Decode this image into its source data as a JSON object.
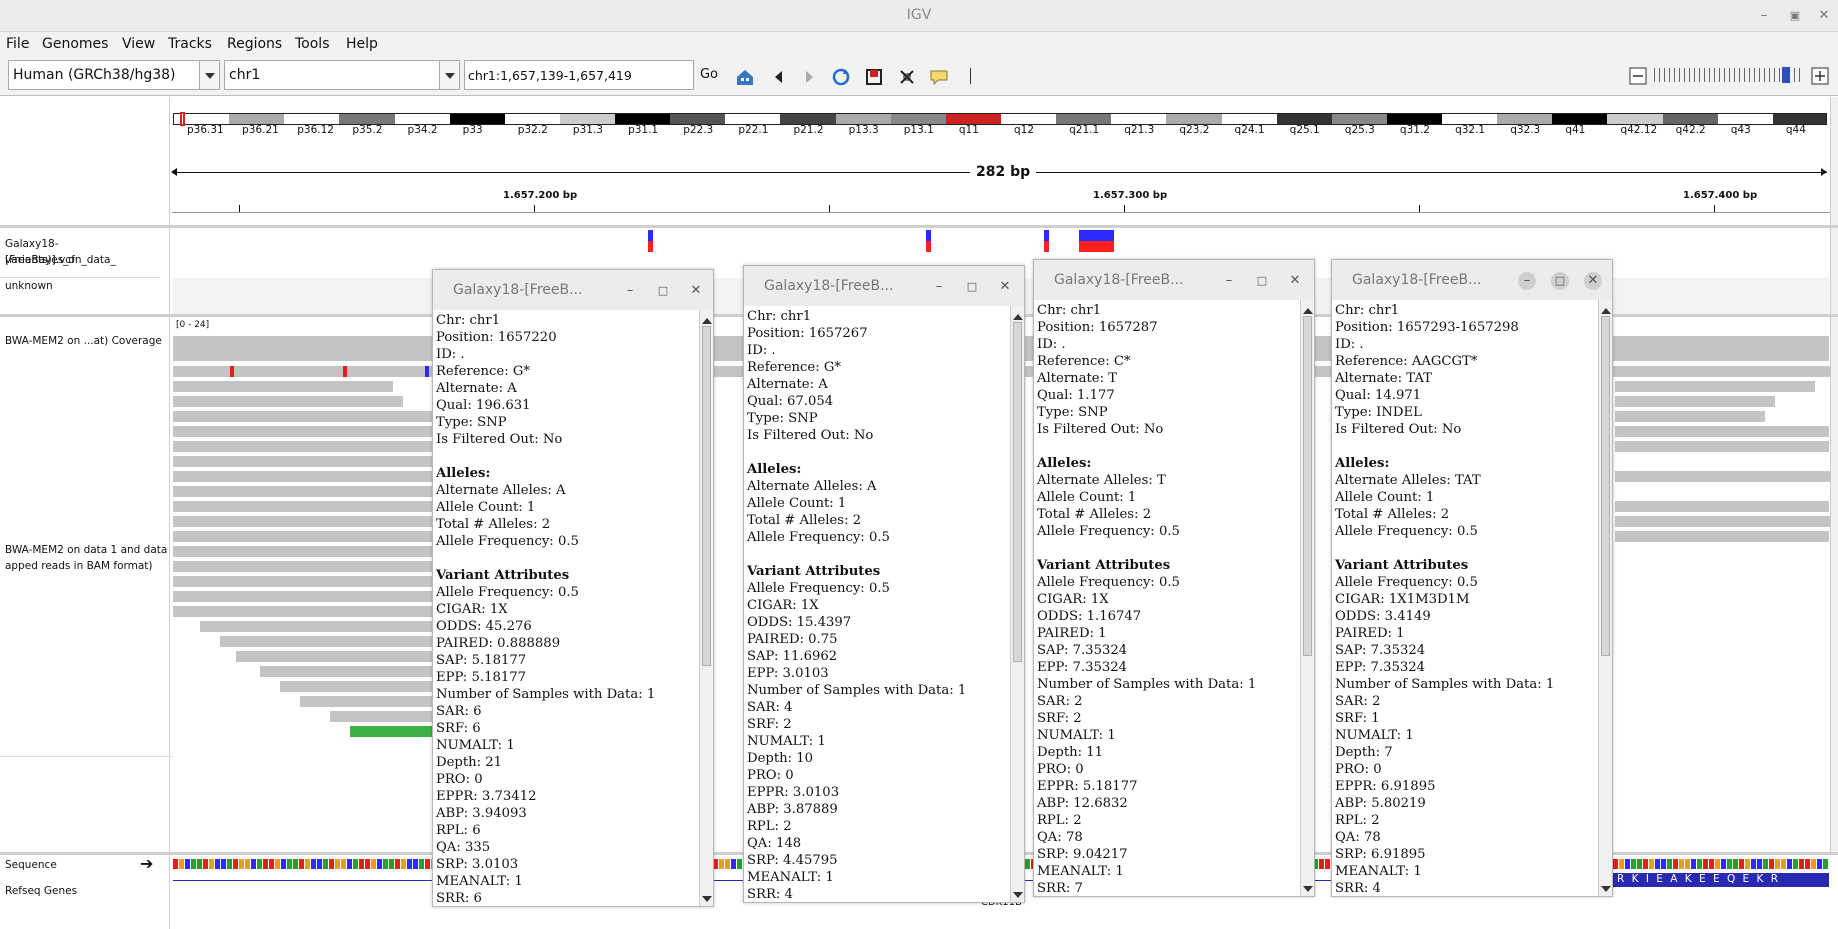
{
  "window": {
    "title": "IGV"
  },
  "menu": [
    "File",
    "Genomes",
    "View",
    "Tracks",
    "Regions",
    "Tools",
    "Help"
  ],
  "toolbar": {
    "genome": "Human (GRCh38/hg38)",
    "chromosome": "chr1",
    "locus": "chr1:1,657,139-1,657,419",
    "go_label": "Go"
  },
  "ideogram": {
    "bands": [
      "p36.31",
      "p36.21",
      "p36.12",
      "p35.2",
      "p34.2",
      "p33",
      "p32.2",
      "p31.3",
      "p31.1",
      "p22.3",
      "p22.1",
      "p21.2",
      "p13.3",
      "p13.1",
      "q11",
      "q12",
      "q21.1",
      "q21.3",
      "q23.2",
      "q24.1",
      "q25.1",
      "q25.3",
      "q31.2",
      "q32.1",
      "q32.3",
      "q41",
      "q42.12",
      "q42.2",
      "q43",
      "q44"
    ]
  },
  "ruler": {
    "span": "282 bp",
    "labels": [
      "1.657.200 bp",
      "1.657.300 bp",
      "1.657.400 bp"
    ]
  },
  "tracks": {
    "vcf_name_1": "Galaxy18-[FreeBayes_on_data_",
    "vcf_name_2": "variants)].vcf",
    "sample": "unknown",
    "coverage": "BWA-MEM2 on ...at) Coverage",
    "coverage_range": "[0 - 24]",
    "alignment_1": "BWA-MEM2 on data 1 and data",
    "alignment_2": "apped reads in BAM format)",
    "sequence": "Sequence",
    "genes": "Refseq Genes",
    "gene_name": "CDK11B",
    "aa_seq": "R K I E A K E E Q E K R"
  },
  "popups": [
    {
      "title": "Galaxy18-[FreeB...",
      "body": "Chr: chr1\nPosition: 1657220\nID: .\nReference: G*\nAlternate: A\nQual: 196.631\nType: SNP\nIs Filtered Out: No\n\n§Alleles:\nAlternate Alleles: A\nAllele Count: 1\nTotal # Alleles: 2\nAllele Frequency: 0.5\n\n§Variant Attributes\nAllele Frequency: 0.5\nCIGAR: 1X\nODDS: 45.276\nPAIRED: 0.888889\nSAP: 5.18177\nEPP: 5.18177\nNumber of Samples with Data: 1\nSAR: 6\nSRF: 6\nNUMALT: 1\nDepth: 21\nPRO: 0\nEPPR: 3.73412\nABP: 3.94093\nRPL: 6\nQA: 335\nSRP: 3.0103\nMEANALT: 1\nSRR: 6"
    },
    {
      "title": "Galaxy18-[FreeB...",
      "body": "Chr: chr1\nPosition: 1657267\nID: .\nReference: G*\nAlternate: A\nQual: 67.054\nType: SNP\nIs Filtered Out: No\n\n§Alleles:\nAlternate Alleles: A\nAllele Count: 1\nTotal # Alleles: 2\nAllele Frequency: 0.5\n\n§Variant Attributes\nAllele Frequency: 0.5\nCIGAR: 1X\nODDS: 15.4397\nPAIRED: 0.75\nSAP: 11.6962\nEPP: 3.0103\nNumber of Samples with Data: 1\nSAR: 4\nSRF: 2\nNUMALT: 1\nDepth: 10\nPRO: 0\nEPPR: 3.0103\nABP: 3.87889\nRPL: 2\nQA: 148\nSRP: 4.45795\nMEANALT: 1\nSRR: 4"
    },
    {
      "title": "Galaxy18-[FreeB...",
      "body": "Chr: chr1\nPosition: 1657287\nID: .\nReference: C*\nAlternate: T\nQual: 1.177\nType: SNP\nIs Filtered Out: No\n\n§Alleles:\nAlternate Alleles: T\nAllele Count: 1\nTotal # Alleles: 2\nAllele Frequency: 0.5\n\n§Variant Attributes\nAllele Frequency: 0.5\nCIGAR: 1X\nODDS: 1.16747\nPAIRED: 1\nSAP: 7.35324\nEPP: 7.35324\nNumber of Samples with Data: 1\nSAR: 2\nSRF: 2\nNUMALT: 1\nDepth: 11\nPRO: 0\nEPPR: 5.18177\nABP: 12.6832\nRPL: 2\nQA: 78\nSRP: 9.04217\nMEANALT: 1\nSRR: 7"
    },
    {
      "title": "Galaxy18-[FreeB...",
      "body": "Chr: chr1\nPosition: 1657293-1657298\nID: .\nReference: AAGCGT*\nAlternate: TAT\nQual: 14.971\nType: INDEL\nIs Filtered Out: No\n\n§Alleles:\nAlternate Alleles: TAT\nAllele Count: 1\nTotal # Alleles: 2\nAllele Frequency: 0.5\n\n§Variant Attributes\nAllele Frequency: 0.5\nCIGAR: 1X1M3D1M\nODDS: 3.4149\nPAIRED: 1\nSAP: 7.35324\nEPP: 7.35324\nNumber of Samples with Data: 1\nSAR: 2\nSRF: 1\nNUMALT: 1\nDepth: 7\nPRO: 0\nEPPR: 6.91895\nABP: 5.80219\nRPL: 2\nQA: 78\nSRP: 6.91895\nMEANALT: 1\nSRR: 4"
    }
  ],
  "colors": {
    "accent": "#2f6fbf",
    "variant_het_top": "#2a2aff",
    "variant_het_bottom": "#ff2020",
    "read_gray": "#c4c4c4",
    "read_green": "#3cb043"
  }
}
